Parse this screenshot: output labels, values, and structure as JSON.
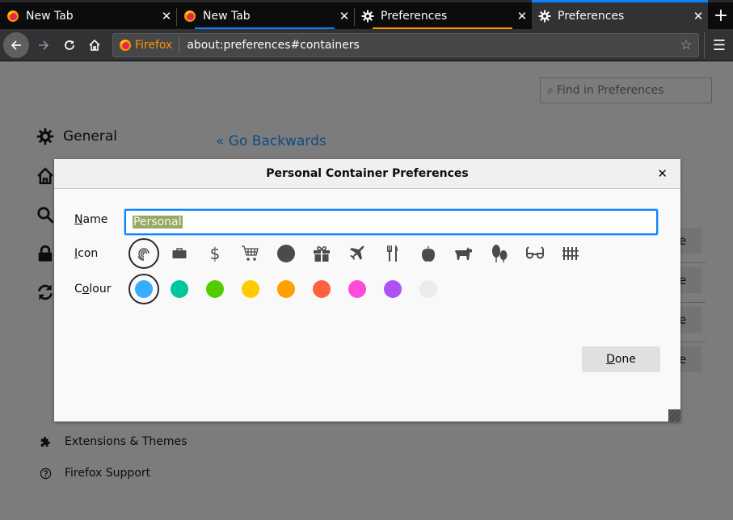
{
  "tabs": [
    {
      "title": "New Tab",
      "icon": "firefox-icon",
      "close": "✕",
      "active": false
    },
    {
      "title": "New Tab",
      "icon": "firefox-icon",
      "close": "✕",
      "active": false,
      "indicator_color": "#0a84ff"
    },
    {
      "title": "Preferences",
      "icon": "gear-icon",
      "close": "✕",
      "active": false,
      "indicator_color": "#ff9400"
    },
    {
      "title": "Preferences",
      "icon": "gear-icon",
      "close": "✕",
      "active": true,
      "indicator_color": "#0a84ff"
    }
  ],
  "new_tab": "+",
  "navbar": {
    "identity_label": "Firefox",
    "url": "about:preferences#containers",
    "star": "☆",
    "menu": "☰"
  },
  "prefs": {
    "search_placeholder": "Find in Preferences",
    "categories": [
      {
        "label": "General",
        "icon": "gear-icon"
      },
      {
        "label": "",
        "icon": "home-icon"
      },
      {
        "label": "",
        "icon": "search-icon"
      },
      {
        "label": "",
        "icon": "lock-icon"
      },
      {
        "label": "",
        "icon": "sync-icon"
      }
    ],
    "footer_links": [
      {
        "label": "Extensions & Themes",
        "icon": "puzzle-icon"
      },
      {
        "label": "Firefox Support",
        "icon": "help-icon"
      }
    ],
    "go_back": "« Go Backwards",
    "row_button_glyph": "e"
  },
  "dialog": {
    "title": "Personal Container Preferences",
    "close": "✕",
    "name_label_accel": "N",
    "name_label_rest": "ame",
    "name_value": "Personal",
    "icon_label_accel": "I",
    "icon_label_rest": "con",
    "colour_label_pre": "C",
    "colour_label_accel": "o",
    "colour_label_rest": "lour",
    "icons": [
      "fingerprint",
      "briefcase",
      "dollar",
      "cart",
      "circle",
      "gift",
      "vacation",
      "food",
      "fruit",
      "pet",
      "tree",
      "chill",
      "fence"
    ],
    "selected_icon": "fingerprint",
    "colours": [
      {
        "name": "blue",
        "hex": "#37adff"
      },
      {
        "name": "turquoise",
        "hex": "#00c79a"
      },
      {
        "name": "green",
        "hex": "#51cd00"
      },
      {
        "name": "yellow",
        "hex": "#ffcb00"
      },
      {
        "name": "orange",
        "hex": "#ff9f00"
      },
      {
        "name": "red",
        "hex": "#ff613d"
      },
      {
        "name": "pink",
        "hex": "#ff4bda"
      },
      {
        "name": "purple",
        "hex": "#af51f5"
      },
      {
        "name": "toolbar",
        "hex": "#ebebeb"
      }
    ],
    "selected_colour": "blue",
    "done_accel": "D",
    "done_rest": "one"
  }
}
